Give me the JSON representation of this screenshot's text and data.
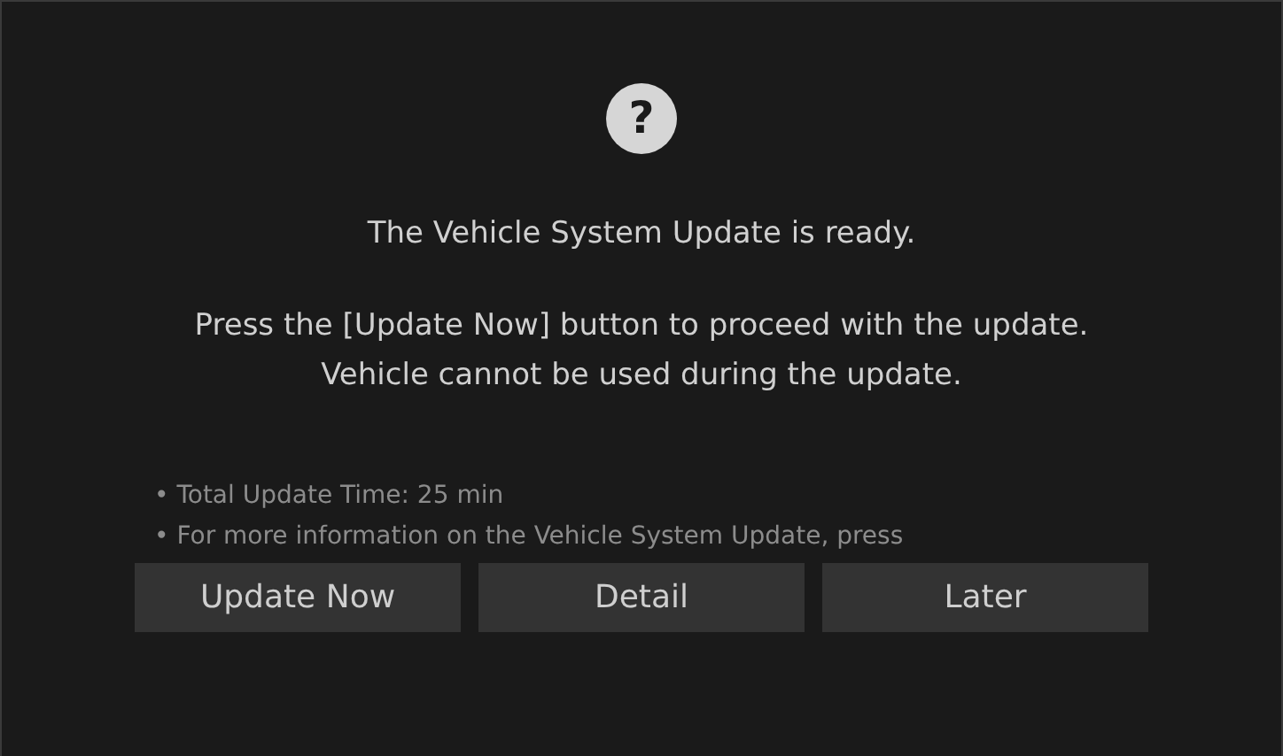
{
  "dialog": {
    "icon": "?",
    "title": "The Vehicle System Update is ready.",
    "message": "Press the [Update Now] button to proceed with the update. Vehicle cannot be used during the update.",
    "notes": [
      "• Total Update Time: 25 min",
      "• For more information on the Vehicle System Update, press"
    ],
    "buttons": [
      "Update Now",
      "Detail",
      "Later"
    ]
  }
}
